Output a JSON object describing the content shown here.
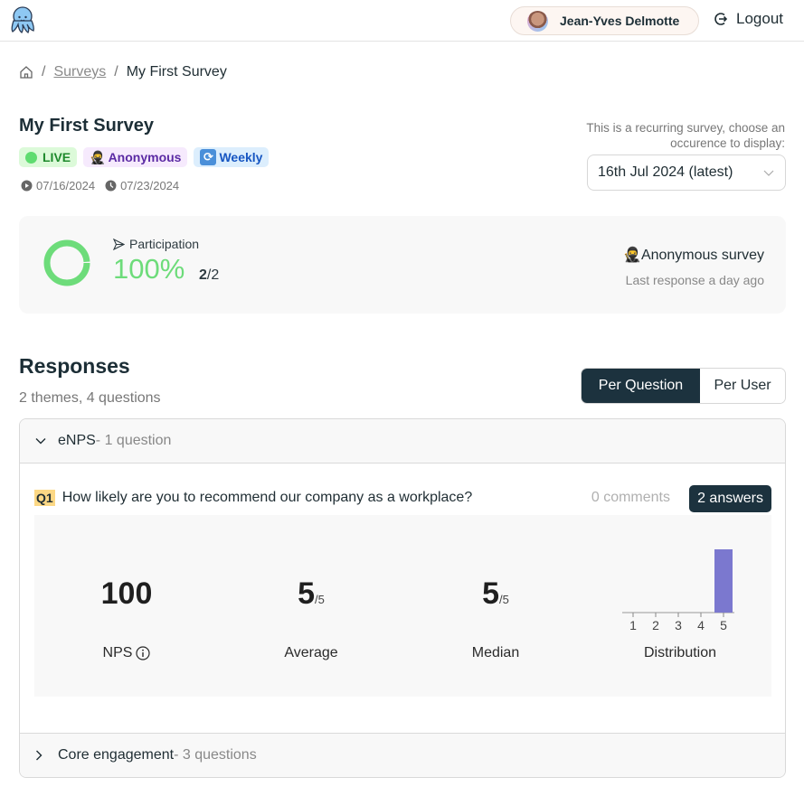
{
  "header": {
    "logo": "octopus-logo",
    "user_name": "Jean-Yves Delmotte",
    "logout_label": "Logout"
  },
  "breadcrumb": {
    "home_icon": "home-icon",
    "separator": "/",
    "items": [
      {
        "label": "Surveys",
        "link": true
      },
      {
        "label": "My First Survey",
        "link": false
      }
    ]
  },
  "survey": {
    "title": "My First Survey",
    "badges": {
      "live": "LIVE",
      "anonymous": "Anonymous",
      "weekly": "Weekly"
    },
    "start_date": "07/16/2024",
    "end_date": "07/23/2024",
    "recurring_note": "This is a recurring survey, choose an occurence to display:",
    "occurrence_selected": "16th Jul 2024 (latest)"
  },
  "participation": {
    "label": "Participation",
    "percent_text": "100%",
    "percent_value": 100,
    "responded": "2",
    "total": "/2",
    "anonymous_label": "Anonymous survey",
    "last_response": "Last response a day ago",
    "color": "#6ddc7a"
  },
  "responses": {
    "title": "Responses",
    "subtitle": "2 themes, 4 questions",
    "view_toggle": [
      {
        "label": "Per Question",
        "active": true
      },
      {
        "label": "Per User",
        "active": false
      }
    ],
    "themes": [
      {
        "name": "eNPS",
        "count": " - 1 question",
        "expanded": true,
        "questions": [
          {
            "number": "Q1",
            "text": "How likely are you to recommend our company as a workplace?",
            "comments": "0 comments",
            "answers": "2 answers",
            "stats": {
              "nps_value": "100",
              "nps_label": "NPS",
              "average_value": "5",
              "average_suffix": "/5",
              "average_label": "Average",
              "median_value": "5",
              "median_suffix": "/5",
              "median_label": "Median",
              "distribution_label": "Distribution"
            }
          }
        ]
      },
      {
        "name": "Core engagement",
        "count": " - 3 questions",
        "expanded": false
      }
    ]
  },
  "chart_data": {
    "type": "bar",
    "title": "Distribution",
    "categories": [
      "1",
      "2",
      "3",
      "4",
      "5"
    ],
    "values": [
      0,
      0,
      0,
      0,
      2
    ],
    "ylim": [
      0,
      2
    ],
    "grid": false,
    "color": "#7b78cf"
  }
}
